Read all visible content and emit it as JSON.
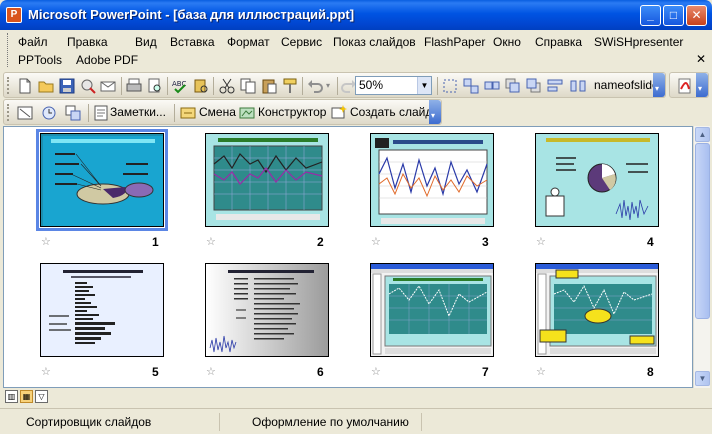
{
  "window": {
    "title": "Microsoft PowerPoint - [база для иллюстраций.ppt]",
    "app_icon_letter": "P"
  },
  "menu": {
    "items": [
      "Файл",
      "Правка",
      "Вид",
      "Вставка",
      "Формат",
      "Сервис",
      "Показ слайдов",
      "FlashPaper",
      "Окно",
      "Справка",
      "SWiSHpresenter"
    ],
    "row2": [
      "PPTools",
      "Adobe PDF"
    ],
    "close_glyph": "✕"
  },
  "toolbar_standard": {
    "zoom_value": "50%",
    "name_label": "nameofslide"
  },
  "toolbar_sorter": {
    "notes_label": "Заметки...",
    "transition_label": "Смена",
    "designer_label": "Конструктор",
    "new_slide_label": "Создать слайд"
  },
  "slides": [
    {
      "num": "1",
      "selected": true
    },
    {
      "num": "2",
      "selected": false
    },
    {
      "num": "3",
      "selected": false
    },
    {
      "num": "4",
      "selected": false
    },
    {
      "num": "5",
      "selected": false
    },
    {
      "num": "6",
      "selected": false
    },
    {
      "num": "7",
      "selected": false
    },
    {
      "num": "8",
      "selected": false
    }
  ],
  "status": {
    "view": "Сортировщик слайдов",
    "design": "Оформление по умолчанию"
  },
  "colors": {
    "titlebar": "#0054e3",
    "selection": "#5b86e5",
    "slide_bg_teal": "#9fe0e0"
  }
}
